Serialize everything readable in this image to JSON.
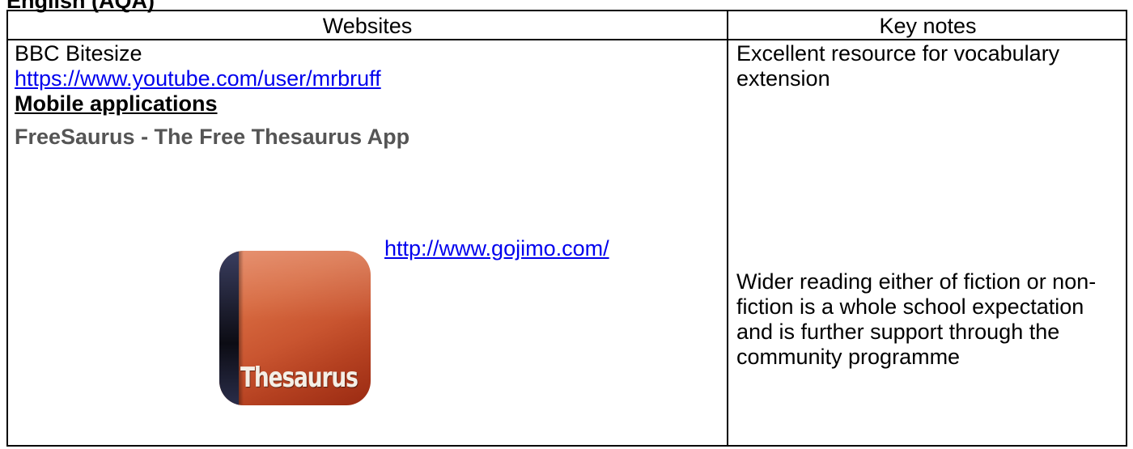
{
  "heading": "English (AQA)",
  "table": {
    "headers": {
      "websites": "Websites",
      "key_notes": "Key notes"
    },
    "websites_cell": {
      "line1": "BBC Bitesize",
      "link1": "https://www.youtube.com/user/mrbruff",
      "section_title": "Mobile applications",
      "app_name": "FreeSaurus - The Free Thesaurus App",
      "link2": "http://www.gojimo.com/",
      "app_icon_text": "Thesaurus",
      "app_icon_name": "thesaurus-book-icon"
    },
    "key_notes_cell": {
      "note1": "Excellent resource for vocabulary extension",
      "note2": "Wider reading either of fiction or non-fiction is a whole school expectation and is further support through the community programme"
    }
  },
  "colors": {
    "link": "#0000ee",
    "app_name": "#555555",
    "border": "#000000"
  }
}
